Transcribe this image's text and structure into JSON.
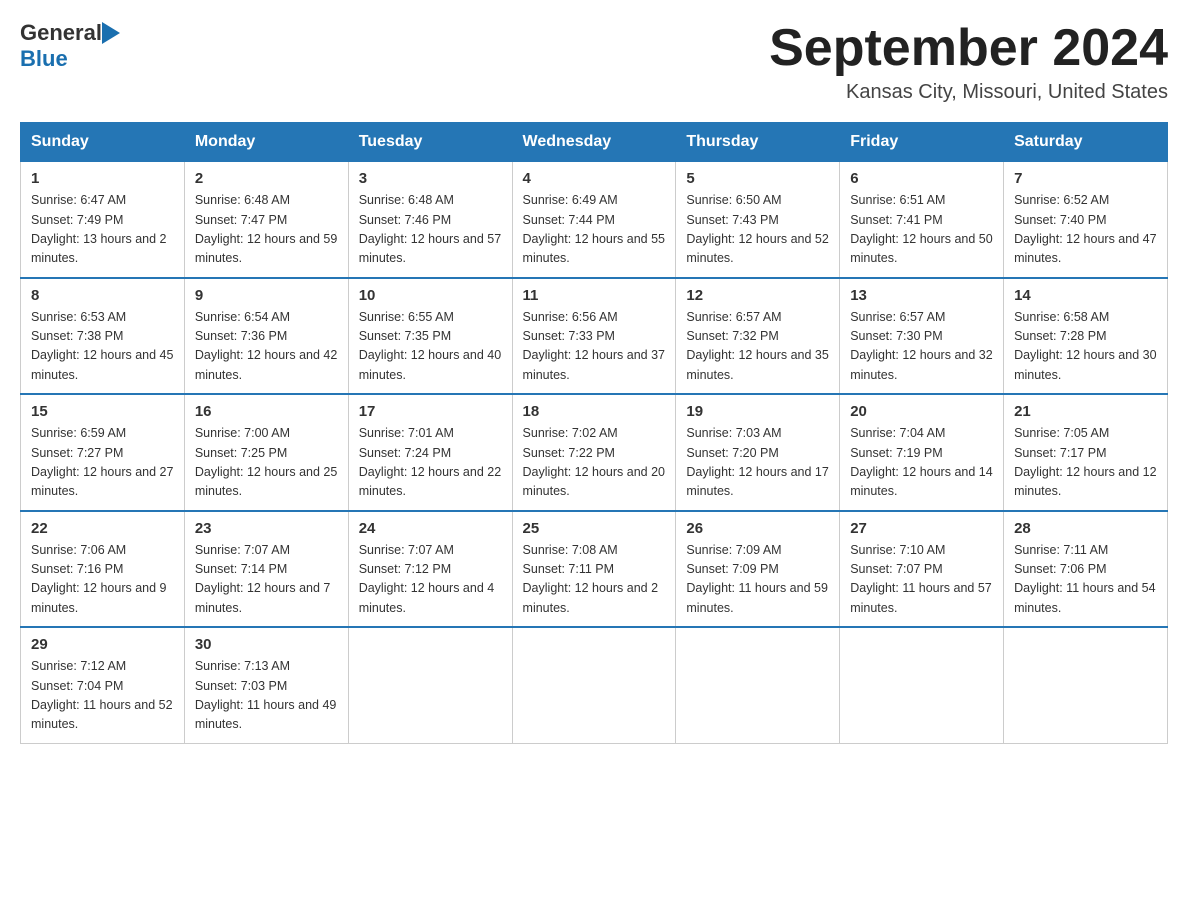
{
  "header": {
    "logo_general": "General",
    "logo_blue": "Blue",
    "title": "September 2024",
    "location": "Kansas City, Missouri, United States"
  },
  "days_of_week": [
    "Sunday",
    "Monday",
    "Tuesday",
    "Wednesday",
    "Thursday",
    "Friday",
    "Saturday"
  ],
  "weeks": [
    [
      {
        "day": "1",
        "sunrise": "6:47 AM",
        "sunset": "7:49 PM",
        "daylight": "13 hours and 2 minutes."
      },
      {
        "day": "2",
        "sunrise": "6:48 AM",
        "sunset": "7:47 PM",
        "daylight": "12 hours and 59 minutes."
      },
      {
        "day": "3",
        "sunrise": "6:48 AM",
        "sunset": "7:46 PM",
        "daylight": "12 hours and 57 minutes."
      },
      {
        "day": "4",
        "sunrise": "6:49 AM",
        "sunset": "7:44 PM",
        "daylight": "12 hours and 55 minutes."
      },
      {
        "day": "5",
        "sunrise": "6:50 AM",
        "sunset": "7:43 PM",
        "daylight": "12 hours and 52 minutes."
      },
      {
        "day": "6",
        "sunrise": "6:51 AM",
        "sunset": "7:41 PM",
        "daylight": "12 hours and 50 minutes."
      },
      {
        "day": "7",
        "sunrise": "6:52 AM",
        "sunset": "7:40 PM",
        "daylight": "12 hours and 47 minutes."
      }
    ],
    [
      {
        "day": "8",
        "sunrise": "6:53 AM",
        "sunset": "7:38 PM",
        "daylight": "12 hours and 45 minutes."
      },
      {
        "day": "9",
        "sunrise": "6:54 AM",
        "sunset": "7:36 PM",
        "daylight": "12 hours and 42 minutes."
      },
      {
        "day": "10",
        "sunrise": "6:55 AM",
        "sunset": "7:35 PM",
        "daylight": "12 hours and 40 minutes."
      },
      {
        "day": "11",
        "sunrise": "6:56 AM",
        "sunset": "7:33 PM",
        "daylight": "12 hours and 37 minutes."
      },
      {
        "day": "12",
        "sunrise": "6:57 AM",
        "sunset": "7:32 PM",
        "daylight": "12 hours and 35 minutes."
      },
      {
        "day": "13",
        "sunrise": "6:57 AM",
        "sunset": "7:30 PM",
        "daylight": "12 hours and 32 minutes."
      },
      {
        "day": "14",
        "sunrise": "6:58 AM",
        "sunset": "7:28 PM",
        "daylight": "12 hours and 30 minutes."
      }
    ],
    [
      {
        "day": "15",
        "sunrise": "6:59 AM",
        "sunset": "7:27 PM",
        "daylight": "12 hours and 27 minutes."
      },
      {
        "day": "16",
        "sunrise": "7:00 AM",
        "sunset": "7:25 PM",
        "daylight": "12 hours and 25 minutes."
      },
      {
        "day": "17",
        "sunrise": "7:01 AM",
        "sunset": "7:24 PM",
        "daylight": "12 hours and 22 minutes."
      },
      {
        "day": "18",
        "sunrise": "7:02 AM",
        "sunset": "7:22 PM",
        "daylight": "12 hours and 20 minutes."
      },
      {
        "day": "19",
        "sunrise": "7:03 AM",
        "sunset": "7:20 PM",
        "daylight": "12 hours and 17 minutes."
      },
      {
        "day": "20",
        "sunrise": "7:04 AM",
        "sunset": "7:19 PM",
        "daylight": "12 hours and 14 minutes."
      },
      {
        "day": "21",
        "sunrise": "7:05 AM",
        "sunset": "7:17 PM",
        "daylight": "12 hours and 12 minutes."
      }
    ],
    [
      {
        "day": "22",
        "sunrise": "7:06 AM",
        "sunset": "7:16 PM",
        "daylight": "12 hours and 9 minutes."
      },
      {
        "day": "23",
        "sunrise": "7:07 AM",
        "sunset": "7:14 PM",
        "daylight": "12 hours and 7 minutes."
      },
      {
        "day": "24",
        "sunrise": "7:07 AM",
        "sunset": "7:12 PM",
        "daylight": "12 hours and 4 minutes."
      },
      {
        "day": "25",
        "sunrise": "7:08 AM",
        "sunset": "7:11 PM",
        "daylight": "12 hours and 2 minutes."
      },
      {
        "day": "26",
        "sunrise": "7:09 AM",
        "sunset": "7:09 PM",
        "daylight": "11 hours and 59 minutes."
      },
      {
        "day": "27",
        "sunrise": "7:10 AM",
        "sunset": "7:07 PM",
        "daylight": "11 hours and 57 minutes."
      },
      {
        "day": "28",
        "sunrise": "7:11 AM",
        "sunset": "7:06 PM",
        "daylight": "11 hours and 54 minutes."
      }
    ],
    [
      {
        "day": "29",
        "sunrise": "7:12 AM",
        "sunset": "7:04 PM",
        "daylight": "11 hours and 52 minutes."
      },
      {
        "day": "30",
        "sunrise": "7:13 AM",
        "sunset": "7:03 PM",
        "daylight": "11 hours and 49 minutes."
      },
      null,
      null,
      null,
      null,
      null
    ]
  ],
  "labels": {
    "sunrise_prefix": "Sunrise: ",
    "sunset_prefix": "Sunset: ",
    "daylight_prefix": "Daylight: "
  }
}
